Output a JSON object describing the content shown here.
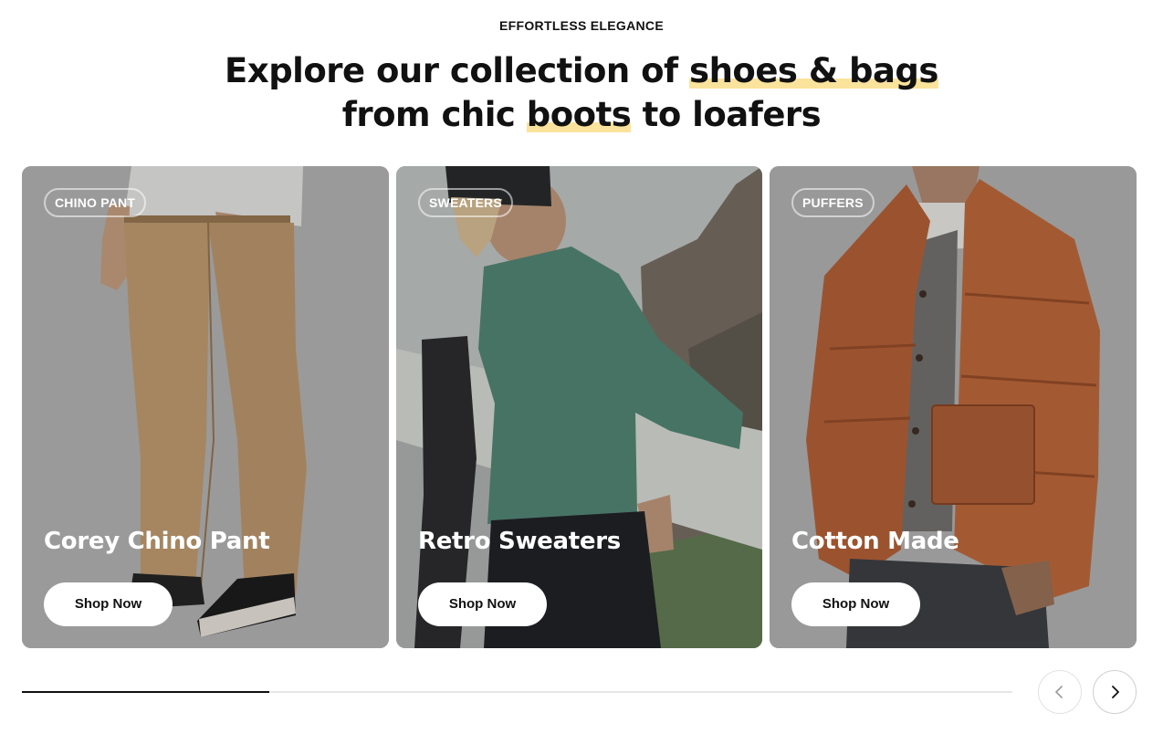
{
  "section": {
    "eyebrow": "EFFORTLESS ELEGANCE",
    "headline": {
      "line1_pre": "Explore our collection of ",
      "line1_highlight": "shoes & bags",
      "line2_pre": "from chic ",
      "line2_highlight": "boots",
      "line2_post": " to loafers"
    }
  },
  "cards": [
    {
      "tag": "CHINO PANT",
      "title": "Corey Chino Pant",
      "button": "Shop Now"
    },
    {
      "tag": "SWEATERS",
      "title": "Retro Sweaters",
      "button": "Shop Now"
    },
    {
      "tag": "PUFFERS",
      "title": "Cotton Made",
      "button": "Shop Now"
    }
  ],
  "carousel": {
    "progress_fraction": 0.25,
    "prev_icon": "chevron-left-icon",
    "next_icon": "chevron-right-icon"
  },
  "colors": {
    "highlight": "#fae39c",
    "text": "#111111",
    "card_overlay": "#a9a9a9"
  }
}
